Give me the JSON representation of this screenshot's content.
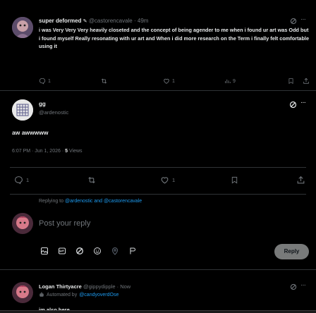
{
  "tweet1": {
    "display_name": "super deformed",
    "handle": "@castorencavale",
    "time": "49m",
    "text": "i was Very Very Very heavily closeted and the concept of being agender to me when i found ur art was Odd but i found myself Really resonating with ur art and When i did more research on the Term i finally felt comfortable using it",
    "replies": "1",
    "likes": "1",
    "views": "9"
  },
  "tweet2": {
    "display_name": "gg",
    "handle": "@ardenostic",
    "text": "aw awwwww",
    "timestamp": "6:07 PM · Jun 1, 2026",
    "views_count": "5",
    "views_label": "Views",
    "replies": "1",
    "likes": "1"
  },
  "reply_box": {
    "replying_prefix": "Replying to",
    "replying_to": "@ardenostic and @castorencavale",
    "placeholder": "Post your reply",
    "reply_button": "Reply"
  },
  "tweet3": {
    "display_name": "Logan Thirtyacre",
    "handle": "@gippydipple",
    "time": "Now",
    "automated_prefix": "Automated by",
    "automated_by": "@candyoverdOse",
    "text": "im also here"
  },
  "colors": {
    "background": "#000000",
    "accent": "#1d9bf0",
    "muted": "#71767b",
    "text": "#e7e9ea",
    "border": "#2f3336"
  }
}
